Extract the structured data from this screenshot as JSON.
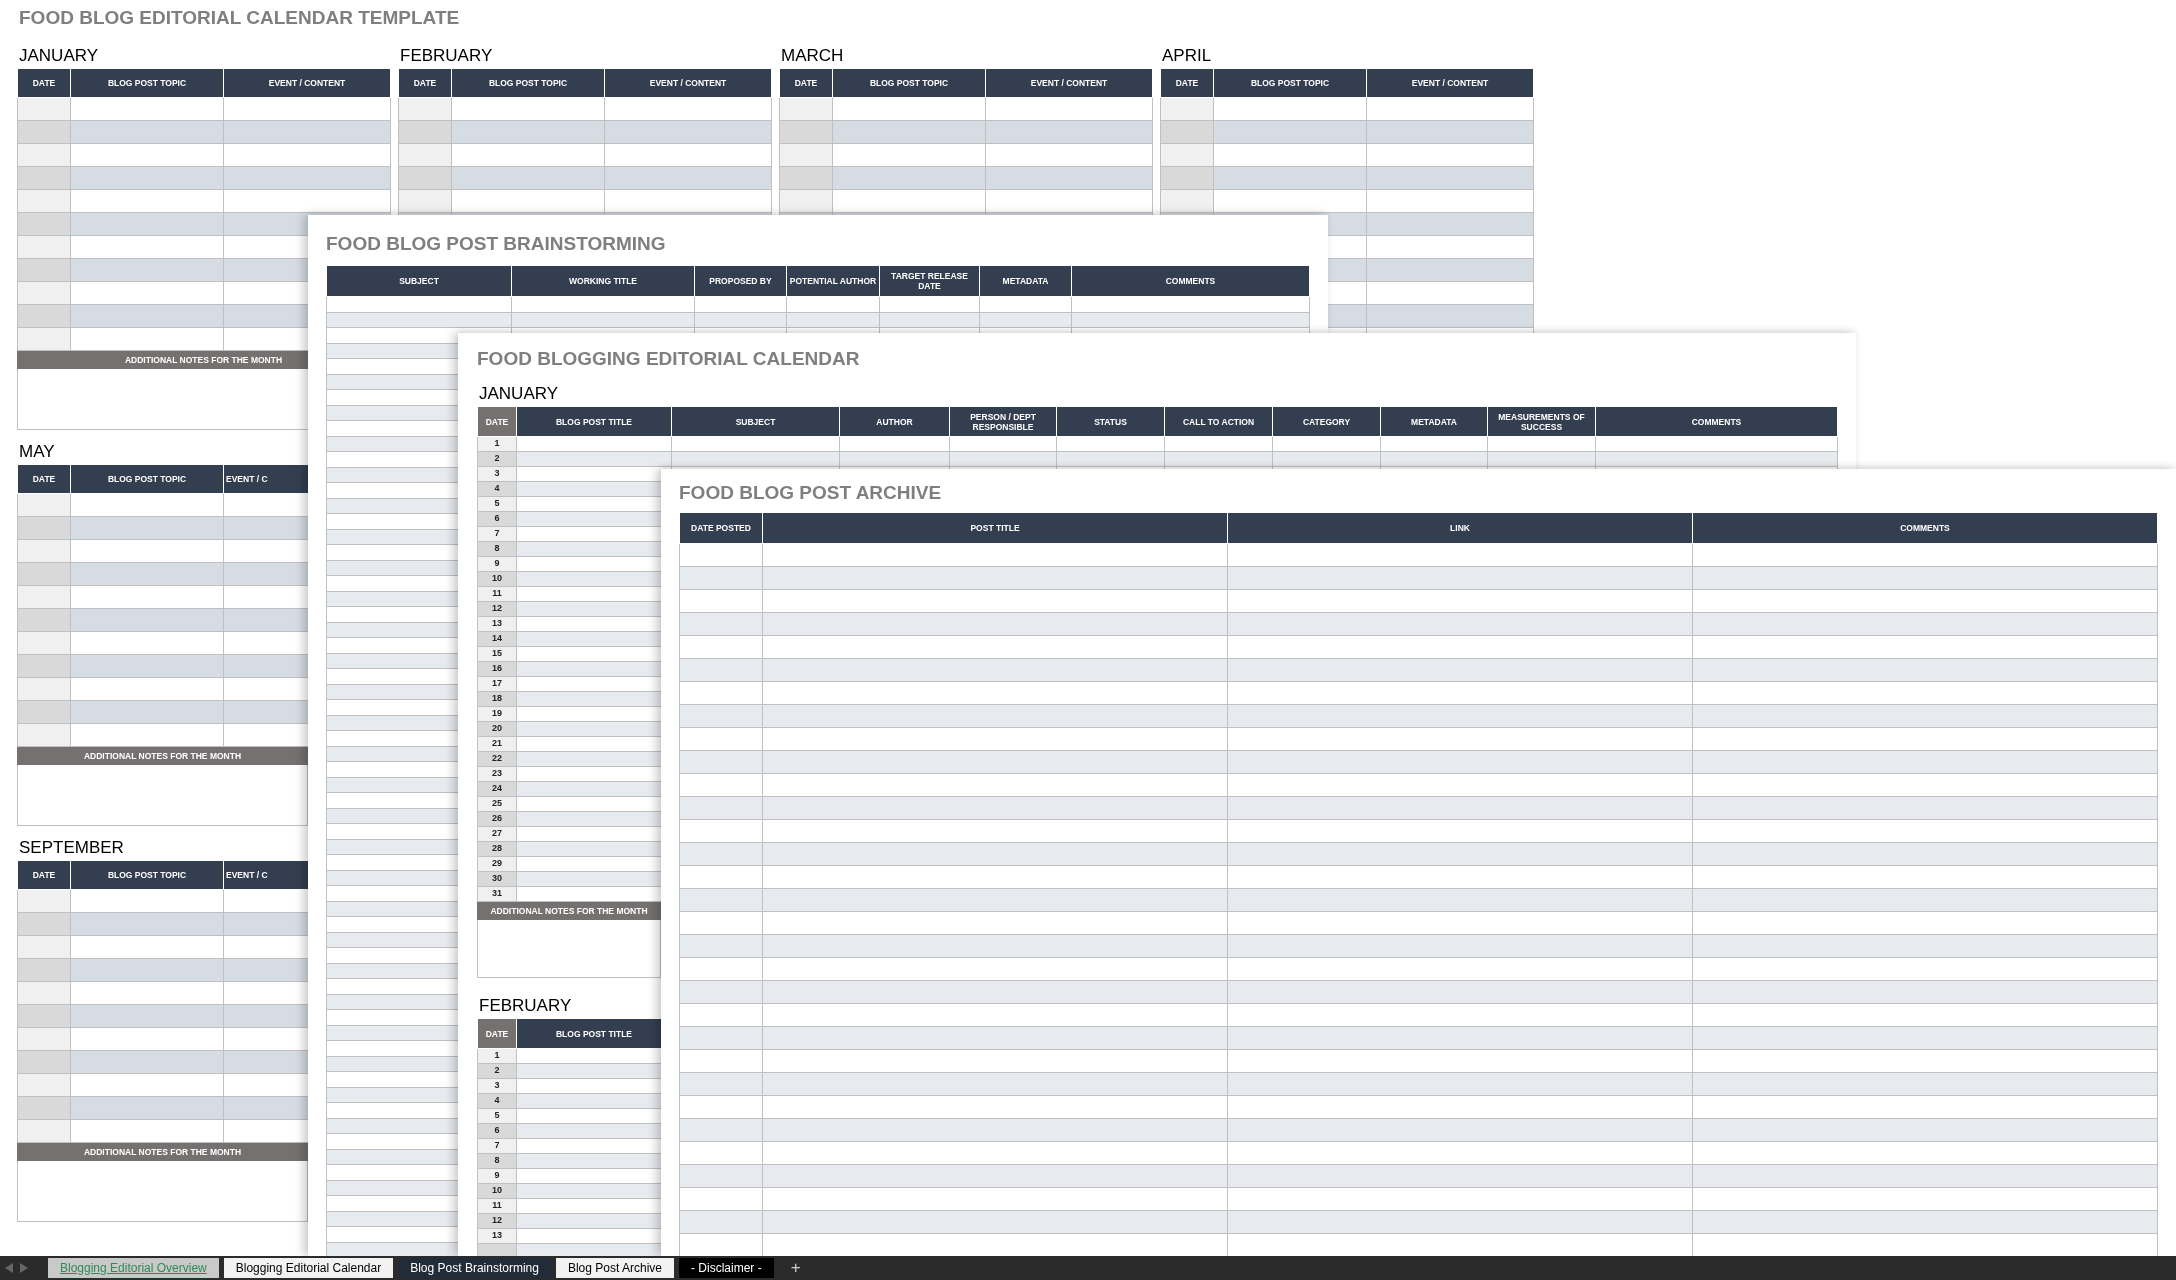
{
  "overview": {
    "title": "FOOD BLOG EDITORIAL CALENDAR TEMPLATE",
    "months": [
      {
        "name": "JANUARY",
        "columns": [
          "DATE",
          "BLOG POST TOPIC",
          "EVENT / CONTENT"
        ],
        "notes": "ADDITIONAL NOTES FOR THE MONTH"
      },
      {
        "name": "FEBRUARY",
        "columns": [
          "DATE",
          "BLOG POST TOPIC",
          "EVENT / CONTENT"
        ]
      },
      {
        "name": "MARCH",
        "columns": [
          "DATE",
          "BLOG POST TOPIC",
          "EVENT / CONTENT"
        ]
      },
      {
        "name": "APRIL",
        "columns": [
          "DATE",
          "BLOG POST TOPIC",
          "EVENT / CONTENT"
        ]
      },
      {
        "name": "MAY",
        "columns": [
          "DATE",
          "BLOG POST TOPIC",
          "EVENT / C"
        ],
        "notes": "ADDITIONAL NOTES FOR THE MONTH"
      },
      {
        "name": "SEPTEMBER",
        "columns": [
          "DATE",
          "BLOG POST TOPIC",
          "EVENT / C"
        ],
        "notes": "ADDITIONAL NOTES FOR THE MONTH"
      }
    ]
  },
  "brainstorming": {
    "title": "FOOD BLOG POST BRAINSTORMING",
    "columns": [
      "SUBJECT",
      "WORKING TITLE",
      "PROPOSED BY",
      "POTENTIAL AUTHOR",
      "TARGET RELEASE DATE",
      "METADATA",
      "COMMENTS"
    ]
  },
  "calendar": {
    "title": "FOOD BLOGGING EDITORIAL CALENDAR",
    "months": [
      {
        "name": "JANUARY",
        "columns": [
          "DATE",
          "BLOG POST TITLE",
          "SUBJECT",
          "AUTHOR",
          "PERSON / DEPT RESPONSIBLE",
          "STATUS",
          "CALL TO ACTION",
          "CATEGORY",
          "METADATA",
          "MEASUREMENTS OF SUCCESS",
          "COMMENTS"
        ],
        "dates": [
          "1",
          "2",
          "3",
          "4",
          "5",
          "6",
          "7",
          "8",
          "9",
          "10",
          "11",
          "12",
          "13",
          "14",
          "15",
          "16",
          "17",
          "18",
          "19",
          "20",
          "21",
          "22",
          "23",
          "24",
          "25",
          "26",
          "27",
          "28",
          "29",
          "30",
          "31"
        ],
        "notes": "ADDITIONAL NOTES FOR THE MONTH"
      },
      {
        "name": "FEBRUARY",
        "columns": [
          "DATE",
          "BLOG POST TITLE"
        ],
        "dates": [
          "1",
          "2",
          "3",
          "4",
          "5",
          "6",
          "7",
          "8",
          "9",
          "10",
          "11",
          "12",
          "13"
        ]
      }
    ]
  },
  "archive": {
    "title": "FOOD BLOG POST ARCHIVE",
    "columns": [
      "DATE POSTED",
      "POST TITLE",
      "LINK",
      "COMMENTS"
    ]
  },
  "tabs": [
    {
      "label": "Blogging Editorial Overview",
      "selected": true,
      "color": "#c9c9c9"
    },
    {
      "label": "Blogging Editorial Calendar",
      "selected": false,
      "color": "#f2f2f2"
    },
    {
      "label": "Blog Post Brainstorming",
      "selected": false,
      "color": "#222b38"
    },
    {
      "label": "Blog Post Archive",
      "selected": false,
      "color": "#f2f2f2"
    },
    {
      "label": "- Disclaimer -",
      "selected": false,
      "color": "#000000"
    }
  ],
  "add_tab": "+"
}
